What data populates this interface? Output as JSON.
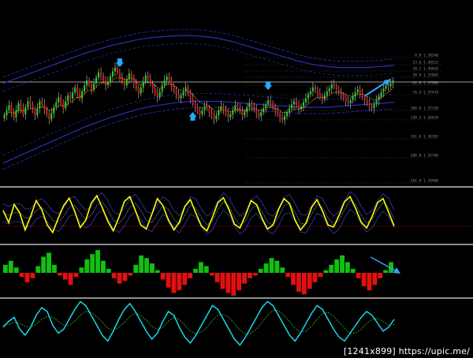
{
  "watermark": "[1241x899] https://upic.me/",
  "colors": {
    "background": "#000000",
    "separator": "#bdbdbd",
    "bull": "#1fd11f",
    "bear": "#e01010",
    "wick": "#c8c8c8",
    "ema": "#f5a623",
    "channel": "#2a2fc0",
    "oscillator": "#ffff00",
    "oscillator_band": "#3b3bb5",
    "histogram_up": "#11c011",
    "histogram_down": "#e31010",
    "cci_line": "#18d8e8",
    "cci_signal": "#2fbf2f",
    "arrow": "#2aa8ff",
    "fib_lines": "#555555",
    "fib_text": "#8a8a8a"
  },
  "chart_data": [
    {
      "type": "candlestick",
      "panel": "price",
      "x": [
        0,
        1,
        2,
        3,
        4,
        5,
        6,
        7,
        8,
        9,
        10,
        11,
        12,
        13,
        14,
        15,
        16,
        17,
        18,
        19,
        20,
        21,
        22,
        23,
        24,
        25,
        26,
        27,
        28,
        29,
        30,
        31,
        32,
        33,
        34,
        35,
        36,
        37,
        38,
        39,
        40,
        41,
        42,
        43,
        44,
        45,
        46,
        47,
        48,
        49,
        50,
        51,
        52,
        53,
        54,
        55,
        56,
        57,
        58,
        59,
        60,
        61,
        62,
        63,
        64,
        65,
        66,
        67,
        68,
        69,
        70,
        71,
        72,
        73,
        74,
        75,
        76,
        77,
        78,
        79,
        80,
        81,
        82,
        83,
        84,
        85,
        86,
        87,
        88,
        89,
        90,
        91,
        92,
        93,
        94,
        95,
        96,
        97,
        98,
        99,
        100,
        101,
        102,
        103,
        104,
        105,
        106,
        107,
        108,
        109,
        110,
        111,
        112,
        113,
        114,
        115,
        116,
        117,
        118,
        119,
        120,
        121,
        122,
        123,
        124,
        125,
        126,
        127,
        128,
        129,
        130,
        131,
        132,
        133,
        134,
        135,
        136,
        137,
        138,
        139,
        140,
        141,
        142,
        143,
        144,
        145,
        146,
        147,
        148,
        149,
        150,
        151,
        152,
        153,
        154,
        155,
        156,
        157,
        158,
        159,
        160,
        161,
        162,
        163,
        164,
        165
      ],
      "close": [
        128,
        133,
        138,
        131,
        126,
        133,
        140,
        135,
        129,
        136,
        142,
        139,
        133,
        128,
        135,
        142,
        139,
        134,
        129,
        124,
        130,
        136,
        141,
        146,
        140,
        135,
        142,
        148,
        145,
        151,
        156,
        150,
        145,
        152,
        158,
        163,
        159,
        154,
        160,
        166,
        171,
        168,
        163,
        158,
        162,
        167,
        172,
        176,
        171,
        166,
        162,
        158,
        164,
        170,
        165,
        160,
        155,
        150,
        156,
        162,
        168,
        165,
        160,
        155,
        150,
        146,
        152,
        158,
        163,
        167,
        162,
        157,
        153,
        149,
        145,
        148,
        152,
        156,
        150,
        145,
        140,
        136,
        132,
        129,
        133,
        137,
        135,
        131,
        127,
        124,
        128,
        133,
        137,
        134,
        130,
        126,
        129,
        133,
        138,
        136,
        132,
        128,
        131,
        136,
        140,
        137,
        134,
        130,
        127,
        131,
        135,
        139,
        143,
        140,
        136,
        132,
        129,
        126,
        123,
        127,
        131,
        135,
        139,
        142,
        138,
        134,
        137,
        141,
        145,
        149,
        152,
        156,
        153,
        150,
        147,
        144,
        148,
        152,
        155,
        159,
        157,
        154,
        151,
        148,
        145,
        142,
        140,
        143,
        147,
        151,
        154,
        150,
        146,
        143,
        140,
        137,
        135,
        139,
        143,
        147,
        151,
        155,
        158,
        157,
        160,
        163
      ],
      "ema": [
        128,
        129,
        131,
        131,
        130,
        131,
        133,
        133,
        132,
        133,
        134,
        135,
        135,
        134,
        134,
        136,
        136,
        136,
        135,
        133,
        133,
        134,
        135,
        137,
        138,
        137,
        138,
        140,
        141,
        142,
        145,
        146,
        146,
        147,
        149,
        152,
        153,
        153,
        154,
        156,
        159,
        160,
        161,
        160,
        160,
        161,
        163,
        165,
        166,
        166,
        165,
        164,
        164,
        165,
        165,
        164,
        162,
        159,
        159,
        159,
        161,
        161,
        161,
        160,
        158,
        156,
        155,
        156,
        157,
        159,
        159,
        159,
        158,
        156,
        154,
        153,
        153,
        153,
        152,
        151,
        149,
        146,
        143,
        141,
        140,
        139,
        138,
        137,
        135,
        133,
        132,
        132,
        133,
        133,
        133,
        132,
        132,
        132,
        133,
        134,
        133,
        133,
        132,
        133,
        134,
        135,
        135,
        134,
        133,
        133,
        133,
        134,
        136,
        136,
        136,
        135,
        134,
        133,
        131,
        131,
        131,
        131,
        132,
        134,
        134,
        134,
        135,
        136,
        137,
        139,
        141,
        143,
        145,
        146,
        146,
        146,
        146,
        147,
        148,
        150,
        151,
        151,
        151,
        151,
        150,
        149,
        148,
        147,
        147,
        148,
        149,
        149,
        149,
        148,
        147,
        146,
        144,
        144,
        144,
        145,
        146,
        148,
        150,
        151,
        153,
        155
      ],
      "upper_channel": [
        160,
        165,
        170,
        175,
        180,
        185,
        190,
        194,
        198,
        201,
        204,
        206,
        207,
        208,
        208,
        207,
        205,
        202,
        198,
        194,
        190,
        186,
        182,
        179,
        177,
        176,
        176,
        176,
        177,
        178
      ],
      "lower_channel": [
        80,
        86,
        92,
        98,
        104,
        110,
        116,
        121,
        126,
        130,
        134,
        137,
        139,
        141,
        142,
        142,
        142,
        141,
        140,
        139,
        138,
        137,
        136,
        136,
        136,
        137,
        138,
        139,
        140,
        141
      ],
      "fib_levels": [
        "0.0 1.38540",
        "23.6 1.38212",
        "38.2 1.38010",
        "50.0 1.37845",
        "61.8 1.37680",
        "76.4 1.37478",
        "100.0 1.37150",
        "138.2 1.36620",
        "161.8 1.36292",
        "200.0 1.35760",
        "261.8 1.34900"
      ],
      "markers": [
        {
          "type": "arrow-down",
          "index": 49
        },
        {
          "type": "arrow-up",
          "index": 80
        },
        {
          "type": "arrow-down",
          "index": 112
        },
        {
          "type": "arrow-up-trend",
          "index": 160
        }
      ]
    },
    {
      "type": "line",
      "panel": "stochastic",
      "series": [
        {
          "values": [
            60,
            35,
            72,
            55,
            20,
            48,
            80,
            62,
            30,
            15,
            44,
            70,
            85,
            58,
            25,
            40,
            75,
            90,
            66,
            38,
            18,
            45,
            78,
            88,
            60,
            30,
            22,
            52,
            84,
            70,
            40,
            20,
            36,
            68,
            82,
            54,
            28,
            18,
            46,
            76,
            86,
            62,
            32,
            24,
            50,
            80,
            72,
            44,
            22,
            30,
            62,
            84,
            74,
            40,
            20,
            34,
            66,
            82,
            58,
            30,
            26,
            50,
            78,
            88,
            64,
            36,
            24,
            48,
            76,
            84,
            56,
            28
          ]
        },
        {
          "values": [
            55,
            50,
            55,
            55,
            45,
            45,
            60,
            66,
            55,
            40,
            35,
            48,
            66,
            70,
            55,
            42,
            50,
            70,
            78,
            62,
            40,
            33,
            46,
            66,
            75,
            60,
            40,
            35,
            52,
            70,
            62,
            42,
            32,
            50,
            70,
            65,
            45,
            30,
            38,
            62,
            78,
            68,
            46,
            30,
            38,
            62,
            72,
            58,
            36,
            30,
            46,
            70,
            74,
            56,
            34,
            32,
            52,
            72,
            66,
            44,
            30,
            40,
            62,
            80,
            72,
            50,
            34,
            42,
            62,
            76,
            66,
            42
          ]
        }
      ]
    },
    {
      "type": "bar",
      "panel": "histogram",
      "values": [
        12,
        18,
        8,
        -6,
        -14,
        -8,
        10,
        24,
        30,
        12,
        -4,
        -10,
        -18,
        -6,
        8,
        20,
        28,
        34,
        18,
        6,
        -8,
        -16,
        -12,
        -4,
        12,
        26,
        22,
        14,
        4,
        -10,
        -22,
        -30,
        -26,
        -18,
        -8,
        6,
        16,
        10,
        -4,
        -14,
        -24,
        -30,
        -34,
        -26,
        -16,
        -8,
        -4,
        6,
        14,
        22,
        18,
        8,
        -6,
        -18,
        -28,
        -32,
        -24,
        -14,
        -6,
        4,
        12,
        20,
        26,
        16,
        6,
        -8,
        -20,
        -26,
        -18,
        -8,
        4,
        16
      ]
    },
    {
      "type": "line",
      "panel": "cci",
      "series": [
        {
          "values": [
            -20,
            10,
            30,
            -30,
            -60,
            -20,
            40,
            80,
            60,
            -10,
            -50,
            -30,
            20,
            70,
            110,
            90,
            40,
            -10,
            -60,
            -90,
            -40,
            20,
            70,
            100,
            60,
            10,
            -40,
            -80,
            -50,
            10,
            60,
            40,
            -20,
            -70,
            -100,
            -60,
            -10,
            40,
            90,
            70,
            20,
            -30,
            -80,
            -110,
            -70,
            -20,
            30,
            80,
            110,
            90,
            40,
            -10,
            -60,
            -90,
            -50,
            0,
            50,
            90,
            70,
            20,
            -30,
            -70,
            -90,
            -50,
            -10,
            30,
            60,
            40,
            0,
            -40,
            -20,
            20
          ]
        },
        {
          "values": [
            -10,
            -5,
            5,
            0,
            -15,
            -20,
            -5,
            20,
            35,
            30,
            10,
            -10,
            -10,
            10,
            40,
            60,
            55,
            35,
            5,
            -25,
            -35,
            -20,
            5,
            35,
            50,
            40,
            15,
            -15,
            -30,
            -20,
            10,
            30,
            20,
            -10,
            -40,
            -55,
            -45,
            -20,
            15,
            40,
            45,
            30,
            0,
            -35,
            -55,
            -50,
            -30,
            5,
            40,
            65,
            65,
            40,
            10,
            -25,
            -45,
            -40,
            -15,
            20,
            50,
            55,
            35,
            5,
            -25,
            -50,
            -50,
            -30,
            0,
            20,
            25,
            10,
            -10,
            -5
          ]
        }
      ]
    }
  ]
}
